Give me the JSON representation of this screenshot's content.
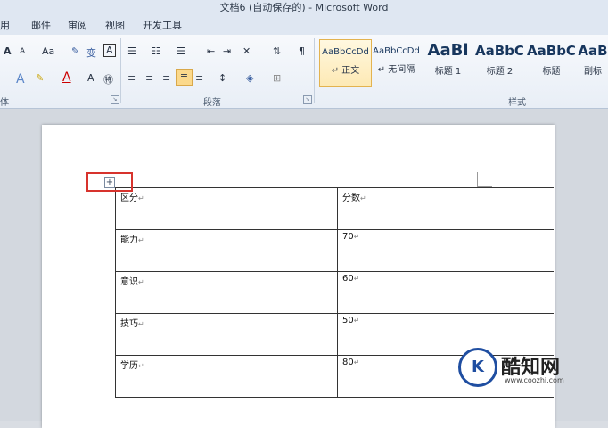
{
  "window": {
    "title": "文档6 (自动保存的) - Microsoft Word"
  },
  "tabs": [
    "用",
    "邮件",
    "审阅",
    "视图",
    "开发工具"
  ],
  "ribbon": {
    "groups": {
      "paragraph": "段落",
      "styles": "样式",
      "font_partial": "体"
    },
    "font_buttons": {
      "grow": "A",
      "shrink": "A",
      "case": "Aa",
      "phonetic": "变",
      "border": "A"
    },
    "styles": [
      {
        "sample": "AaBbCcDd",
        "name": "↵ 正文"
      },
      {
        "sample": "AaBbCcDd",
        "name": "↵ 无间隔"
      },
      {
        "sample": "AaBl",
        "name": "标题 1"
      },
      {
        "sample": "AaBbC",
        "name": "标题 2"
      },
      {
        "sample": "AaBbC",
        "name": "标题"
      },
      {
        "sample": "AaB",
        "name": "副标"
      }
    ]
  },
  "document": {
    "table": {
      "rows": [
        [
          "区分",
          "分数"
        ],
        [
          "能力",
          "70"
        ],
        [
          "意识",
          "60"
        ],
        [
          "技巧",
          "50"
        ],
        [
          "学历",
          "80"
        ]
      ]
    },
    "paragraph_mark": "↵"
  },
  "watermark": {
    "name": "酷知网",
    "url": "www.coozhi.com",
    "logo_letter": "K"
  },
  "colors": {
    "highlight_box": "#d7332d",
    "ribbon_bg": "#e8eef6",
    "style_active": "#fde9b4"
  }
}
